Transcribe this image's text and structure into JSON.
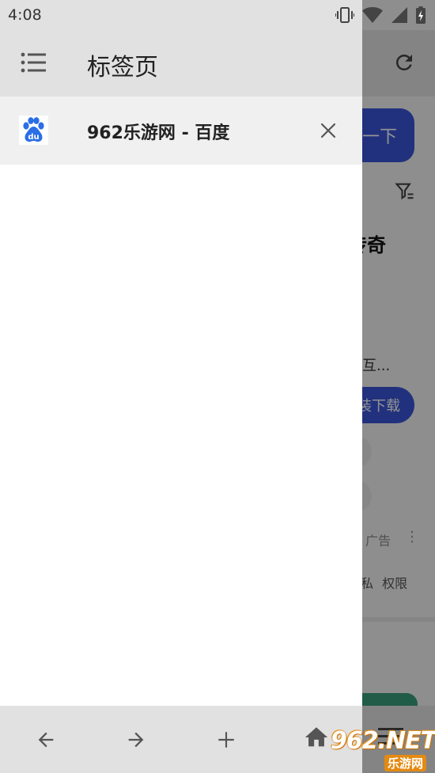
{
  "status_bar": {
    "time": "4:08",
    "icons": [
      "vibrate-icon",
      "wifi-icon",
      "signal-icon",
      "battery-charging-icon"
    ]
  },
  "drawer": {
    "title": "标签页",
    "tabs": [
      {
        "title": "962乐游网 - 百度",
        "favicon": "baidu-paw-icon",
        "favicon_text": "du"
      }
    ]
  },
  "bottom_nav": {
    "buttons": [
      {
        "name": "back",
        "icon": "arrow-left-icon"
      },
      {
        "name": "forward",
        "icon": "arrow-right-icon"
      },
      {
        "name": "new-tab",
        "icon": "plus-icon"
      },
      {
        "name": "home",
        "icon": "home-icon"
      }
    ]
  },
  "background_page": {
    "search_button_label": "一下",
    "result_title": "传奇",
    "result_desc": "端互...",
    "download_button_label": "装下载",
    "ad_label": "广告",
    "footer_links": "隐私 权限"
  },
  "watermark": {
    "logo_text": "962.NET",
    "sub_text": "乐游网"
  },
  "colors": {
    "accent": "#3a55d8",
    "header_gray": "#e1e1e1",
    "tab_selected": "#f0f0f0",
    "baidu_blue": "#2a6ee8"
  }
}
